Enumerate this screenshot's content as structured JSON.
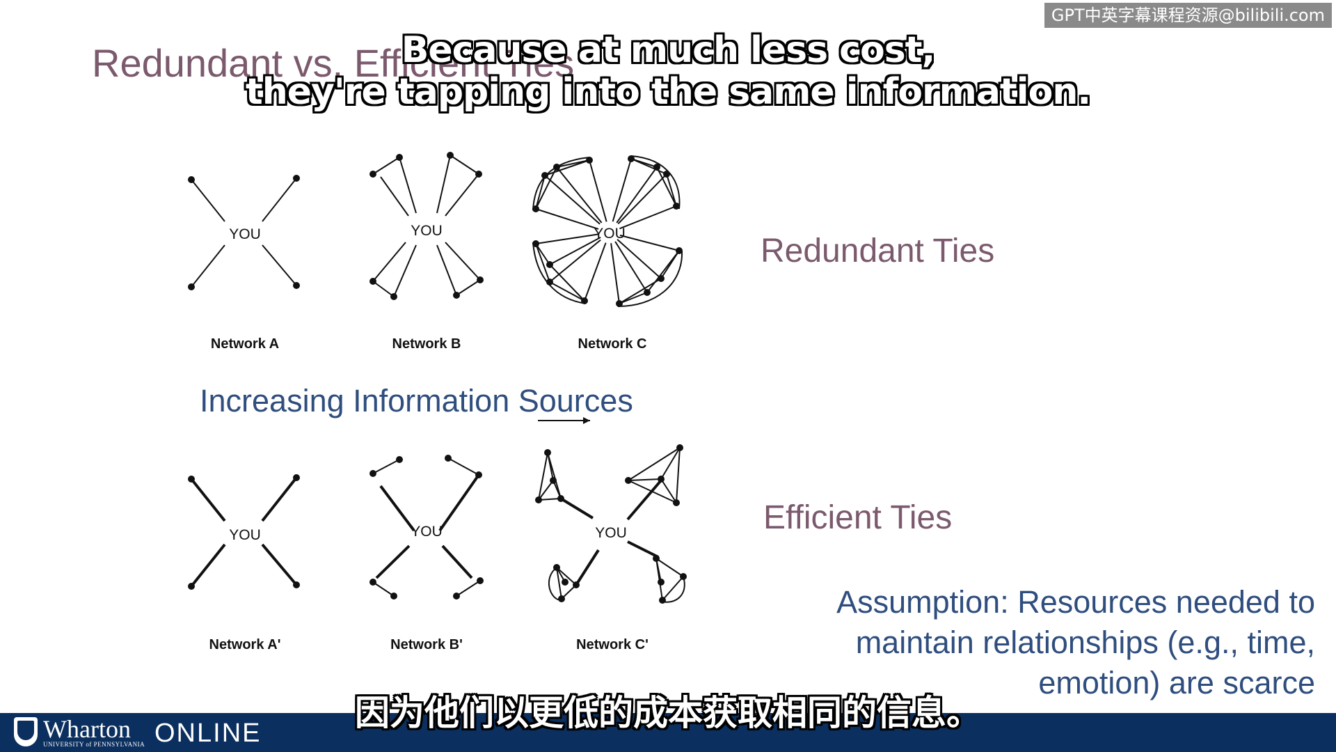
{
  "watermark": "GPT中英字幕课程资源@bilibili.com",
  "slide": {
    "title": "Redundant vs. Efficient Ties",
    "redundant_label": "Redundant Ties",
    "efficient_label": "Efficient Ties",
    "increasing_label": "Increasing Information Sources",
    "center_label": "YOU",
    "networks_top": [
      "Network A",
      "Network B",
      "Network C"
    ],
    "networks_bottom": [
      "Network A'",
      "Network B'",
      "Network C'"
    ],
    "assumption_lines": [
      "Assumption: Resources needed to",
      "maintain relationships (e.g., time,",
      "emotion) are scarce"
    ]
  },
  "subtitles": {
    "en_line1": "Because at much less cost,",
    "en_line2": "they're tapping into the same information.",
    "zh": "因为他们以更低的成本获取相同的信息。"
  },
  "footer": {
    "brand": "Wharton",
    "brand_sub": "UNIVERSITY of PENNSYLVANIA",
    "product": "ONLINE"
  },
  "colors": {
    "title": "#7b5a6d",
    "blue_text": "#2f4e7e",
    "footer_bg": "#0b2f5e"
  }
}
